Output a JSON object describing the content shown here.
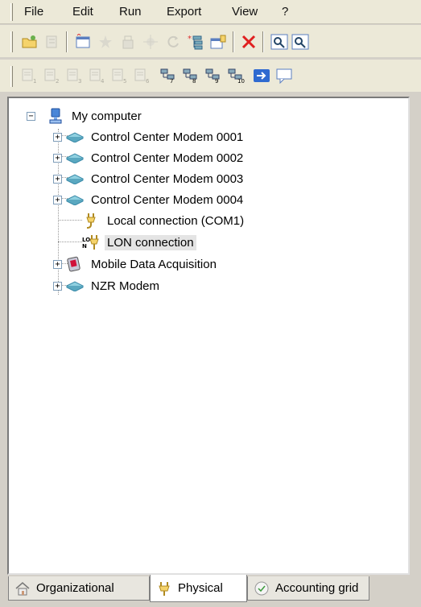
{
  "menu": [
    "File",
    "Edit",
    "Run",
    "Export",
    "View",
    "?"
  ],
  "toolbar1": [
    {
      "icon": "open-folder-icon",
      "enabled": true
    },
    {
      "icon": "properties-icon",
      "enabled": false
    },
    {
      "icon": "new-window-icon",
      "enabled": true
    },
    {
      "icon": "star-icon",
      "enabled": false
    },
    {
      "icon": "tool-icon",
      "enabled": false
    },
    {
      "icon": "sparkle-icon",
      "enabled": false
    },
    {
      "icon": "refresh-icon",
      "enabled": false
    },
    {
      "icon": "add-tree-icon",
      "enabled": true
    },
    {
      "icon": "edit-window-icon",
      "enabled": true
    },
    {
      "icon": "delete-icon",
      "enabled": true
    },
    {
      "icon": "search-icon",
      "enabled": true
    },
    {
      "icon": "search-next-icon",
      "enabled": true
    }
  ],
  "toolbar2": [
    {
      "icon": "page-1-icon",
      "label": "1",
      "enabled": false
    },
    {
      "icon": "page-2-icon",
      "label": "2",
      "enabled": false
    },
    {
      "icon": "page-3-icon",
      "label": "3",
      "enabled": false
    },
    {
      "icon": "page-4-icon",
      "label": "4",
      "enabled": false
    },
    {
      "icon": "page-5-icon",
      "label": "5",
      "enabled": false
    },
    {
      "icon": "page-6-icon",
      "label": "6",
      "enabled": false
    },
    {
      "icon": "network-7-icon",
      "label": "7",
      "enabled": true
    },
    {
      "icon": "network-8-icon",
      "label": "8",
      "enabled": true
    },
    {
      "icon": "network-9-icon",
      "label": "9",
      "enabled": true
    },
    {
      "icon": "network-10-icon",
      "label": "10",
      "enabled": true
    },
    {
      "icon": "arrow-right-icon",
      "label": "",
      "enabled": true
    },
    {
      "icon": "comment-icon",
      "label": "",
      "enabled": true
    }
  ],
  "tree": {
    "root": "My computer",
    "children": [
      {
        "label": "Control Center Modem 0001",
        "icon": "modem-icon",
        "expandable": true
      },
      {
        "label": "Control Center Modem 0002",
        "icon": "modem-icon",
        "expandable": true
      },
      {
        "label": "Control Center Modem 0003",
        "icon": "modem-icon",
        "expandable": true
      },
      {
        "label": "Control Center Modem 0004",
        "icon": "modem-icon",
        "expandable": true
      },
      {
        "label": "Local connection (COM1)",
        "icon": "plug-icon",
        "expandable": false
      },
      {
        "label": "LON connection",
        "icon": "lon-plug-icon",
        "expandable": false,
        "selected": true
      },
      {
        "label": "Mobile Data Acquisition",
        "icon": "mobile-device-icon",
        "expandable": true
      },
      {
        "label": "NZR Modem",
        "icon": "modem-icon",
        "expandable": true
      }
    ]
  },
  "tabs": [
    {
      "label": "Organizational",
      "icon": "house-icon",
      "active": false
    },
    {
      "label": "Physical",
      "icon": "plug-icon",
      "active": true
    },
    {
      "label": "Accounting grid",
      "icon": "check-circle-icon",
      "active": false
    }
  ]
}
